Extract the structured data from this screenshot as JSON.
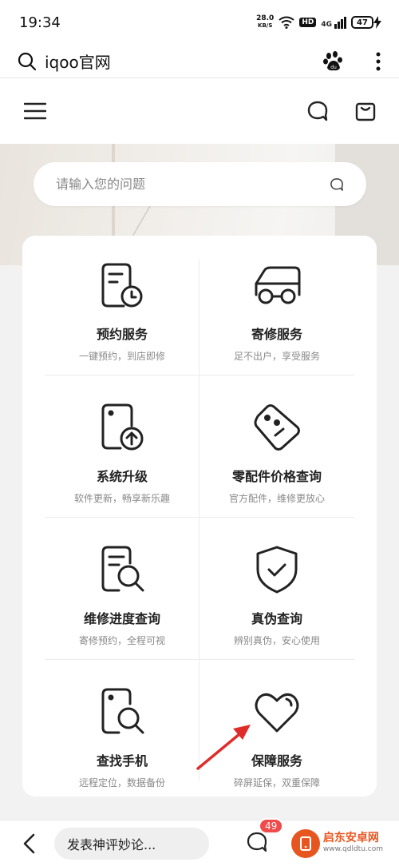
{
  "status_bar": {
    "time": "19:34",
    "net_speed": "28.0",
    "net_unit": "KB/S",
    "hd": "HD",
    "signal": "4G",
    "battery": "47"
  },
  "browser": {
    "query": "iqoo官网",
    "icons": [
      "search-icon",
      "baidu-paw-icon",
      "more-vertical-icon"
    ]
  },
  "site_header": {
    "icons": [
      "menu-icon",
      "chat-icon",
      "bag-icon"
    ]
  },
  "search": {
    "placeholder": "请输入您的问题"
  },
  "services": [
    {
      "title": "预约服务",
      "subtitle": "一键预约，到店即修",
      "icon": "calendar-clock-icon"
    },
    {
      "title": "寄修服务",
      "subtitle": "足不出户，享受服务",
      "icon": "car-icon"
    },
    {
      "title": "系统升级",
      "subtitle": "软件更新，畅享新乐趣",
      "icon": "phone-upgrade-icon"
    },
    {
      "title": "零配件价格查询",
      "subtitle": "官方配件，维修更放心",
      "icon": "price-tag-icon"
    },
    {
      "title": "维修进度查询",
      "subtitle": "寄修预约，全程可视",
      "icon": "document-search-icon"
    },
    {
      "title": "真伪查询",
      "subtitle": "辨别真伪，安心使用",
      "icon": "shield-check-icon"
    },
    {
      "title": "查找手机",
      "subtitle": "远程定位，数据备份",
      "icon": "phone-search-icon"
    },
    {
      "title": "保障服务",
      "subtitle": "碎屏延保，双重保障",
      "icon": "heart-icon"
    }
  ],
  "bottom_bar": {
    "comment_placeholder": "发表神评妙论...",
    "comment_count": "49",
    "watermark_cn": "启东安卓网",
    "watermark_url": "www.qdldtu.com"
  },
  "colors": {
    "badge": "#f14a4a",
    "arrow": "#e02b2b"
  }
}
